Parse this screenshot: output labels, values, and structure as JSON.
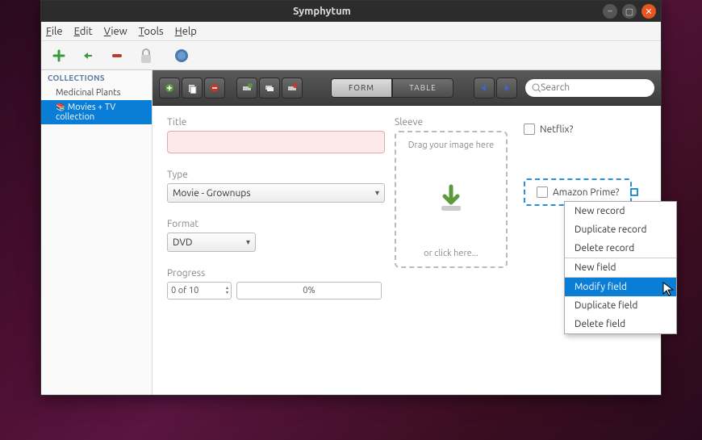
{
  "window": {
    "title": "Symphytum"
  },
  "menubar": {
    "file": "File",
    "edit": "Edit",
    "view": "View",
    "tools": "Tools",
    "help": "Help"
  },
  "sidebar": {
    "heading": "COLLECTIONS",
    "items": [
      "Medicinal Plants",
      "Movies + TV collection"
    ],
    "selected": 1
  },
  "main_toolbar": {
    "view_modes": {
      "form": "FORM",
      "table": "TABLE",
      "active": "form"
    },
    "search_placeholder": "Search"
  },
  "form": {
    "title": {
      "label": "Title",
      "value": ""
    },
    "type": {
      "label": "Type",
      "value": "Movie - Grownups"
    },
    "format": {
      "label": "Format",
      "value": "DVD"
    },
    "progress": {
      "label": "Progress",
      "value": "0 of 10",
      "percent": "0%"
    },
    "sleeve": {
      "label": "Sleeve",
      "hint_top": "Drag your image here",
      "hint_bottom": "or click here..."
    },
    "netflix": {
      "label": "Netflix?",
      "checked": false
    },
    "amazon": {
      "label": "Amazon Prime?",
      "checked": false
    }
  },
  "context_menu": {
    "items": [
      "New record",
      "Duplicate record",
      "Delete record",
      "New field",
      "Modify field",
      "Duplicate field",
      "Delete field"
    ],
    "separator_after": [
      2,
      3
    ],
    "highlighted": 4
  }
}
